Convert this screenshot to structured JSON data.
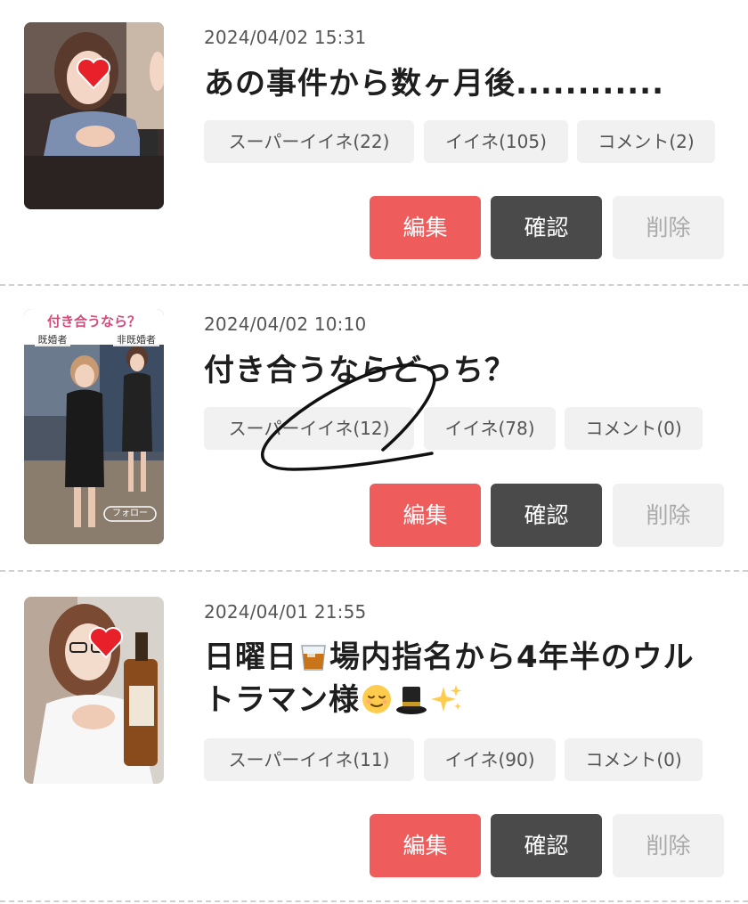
{
  "posts": [
    {
      "date": "2024/04/02 15:31",
      "title": "あの事件から数ヶ月後............",
      "stats": {
        "super_like": "スーパーイイネ(22)",
        "like": "イイネ(105)",
        "comment": "コメント(2)"
      },
      "thumbnail_icon": "heart-sticker-icon"
    },
    {
      "date": "2024/04/02 10:10",
      "title": "付き合うならどっち？",
      "stats": {
        "super_like": "スーパーイイネ(12)",
        "like": "イイネ(78)",
        "comment": "コメント(0)"
      },
      "thumbnail_text": {
        "banner": "付き合うなら？",
        "label_left": "既婚者",
        "label_right": "非既婚者",
        "follow": "フォロー"
      }
    },
    {
      "date": "2024/04/01 21:55",
      "title_part1": "日曜日",
      "title_part2": "場内指名から4年半のウル",
      "title_part3": "トラマン様",
      "title_emojis": [
        "whisky-glass-icon",
        "relieved-face-icon",
        "top-hat-icon",
        "sparkles-icon"
      ],
      "stats": {
        "super_like": "スーパーイイネ(11)",
        "like": "イイネ(90)",
        "comment": "コメント(0)"
      },
      "thumbnail_icon": "heart-sticker-icon"
    }
  ],
  "buttons": {
    "edit": "編集",
    "confirm": "確認",
    "delete": "削除"
  },
  "colors": {
    "edit_button": "#ee5c5c",
    "confirm_button": "#4a4a4a",
    "delete_button": "#f1f1f1",
    "stat_chip": "#f1f1f1",
    "scribble": "#111111"
  }
}
